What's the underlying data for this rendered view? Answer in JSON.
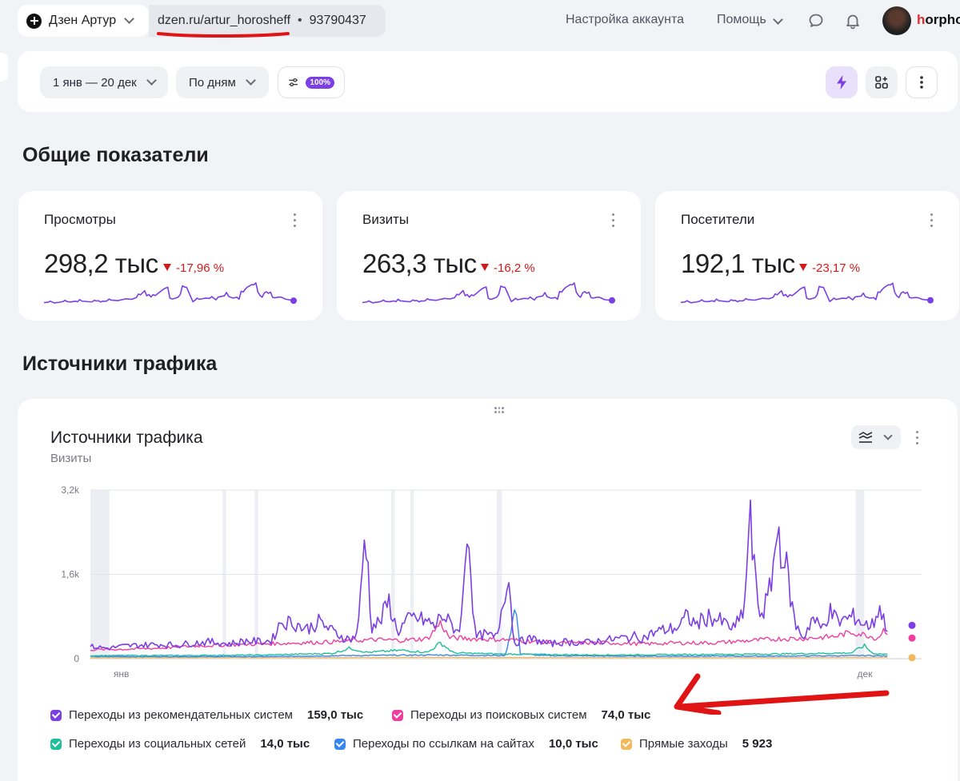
{
  "topbar": {
    "channel_name": "Дзен Артур",
    "url": "dzen.ru/artur_horosheff",
    "separator": "•",
    "channel_id": "93790437",
    "account_settings": "Настройка аккаунта",
    "help": "Помощь",
    "username_first": "h",
    "username_rest": "orpho",
    "icons": [
      "chevron-down-icon",
      "chat-icon",
      "bell-icon",
      "avatar"
    ]
  },
  "filters": {
    "date_range": "1 янв — 20 дек",
    "grouping": "По дням",
    "sampling_badge": "100%",
    "icons": [
      "sliders-icon",
      "lightning-icon",
      "widgets-icon",
      "more-icon"
    ]
  },
  "sections": {
    "overview_title": "Общие показатели",
    "traffic_title": "Источники трафика"
  },
  "metrics": [
    {
      "title": "Просмотры",
      "value": "298,2 тыс",
      "delta": "-17,96 %"
    },
    {
      "title": "Визиты",
      "value": "263,3 тыс",
      "delta": "-16,2 %"
    },
    {
      "title": "Посетители",
      "value": "192,1 тыс",
      "delta": "-23,17 %"
    }
  ],
  "traffic_card": {
    "title": "Источники трафика",
    "subtitle": "Визиты"
  },
  "colors": {
    "accent": "#7b3fe4",
    "negative": "#d11a1a",
    "series_recommend": "#7b3fe4",
    "series_search": "#ee3f9f",
    "series_social": "#1fbf9a",
    "series_links": "#3a86f0",
    "series_direct": "#f2b95c"
  },
  "chart_data": {
    "type": "line",
    "title": "Источники трафика",
    "subtitle": "Визиты",
    "y_ticks": [
      "3,2k",
      "1,6k",
      "0"
    ],
    "ylim": [
      0,
      3200
    ],
    "x_tick_labels": [
      "янв",
      "дек"
    ],
    "x_range": [
      "1 янв",
      "20 дек"
    ],
    "grid": true,
    "legend_position": "bottom",
    "series": [
      {
        "name": "Переходы из рекомендательных систем",
        "total": "159,0 тыс",
        "color": "#7b3fe4",
        "keypoints": [
          [
            0,
            230
          ],
          [
            20,
            200
          ],
          [
            40,
            240
          ],
          [
            60,
            260
          ],
          [
            80,
            270
          ],
          [
            100,
            260
          ],
          [
            120,
            300
          ],
          [
            140,
            320
          ],
          [
            160,
            280
          ],
          [
            180,
            340
          ],
          [
            200,
            320
          ],
          [
            210,
            350
          ],
          [
            220,
            700
          ],
          [
            235,
            680
          ],
          [
            250,
            560
          ],
          [
            265,
            700
          ],
          [
            280,
            520
          ],
          [
            295,
            380
          ],
          [
            305,
            390
          ],
          [
            310,
            620
          ],
          [
            318,
            2530
          ],
          [
            325,
            600
          ],
          [
            335,
            700
          ],
          [
            345,
            1100
          ],
          [
            355,
            500
          ],
          [
            365,
            700
          ],
          [
            375,
            780
          ],
          [
            390,
            700
          ],
          [
            400,
            600
          ],
          [
            405,
            860
          ],
          [
            415,
            680
          ],
          [
            425,
            520
          ],
          [
            430,
            820
          ],
          [
            436,
            2730
          ],
          [
            445,
            400
          ],
          [
            455,
            460
          ],
          [
            470,
            400
          ],
          [
            483,
            1680
          ],
          [
            490,
            300
          ],
          [
            510,
            380
          ],
          [
            530,
            280
          ],
          [
            550,
            320
          ],
          [
            570,
            300
          ],
          [
            590,
            340
          ],
          [
            610,
            380
          ],
          [
            630,
            420
          ],
          [
            640,
            400
          ],
          [
            655,
            520
          ],
          [
            670,
            560
          ],
          [
            680,
            600
          ],
          [
            690,
            800
          ],
          [
            700,
            650
          ],
          [
            715,
            800
          ],
          [
            730,
            700
          ],
          [
            745,
            560
          ],
          [
            755,
            900
          ],
          [
            758,
            1200
          ],
          [
            762,
            2820
          ],
          [
            768,
            1600
          ],
          [
            775,
            800
          ],
          [
            785,
            1200
          ],
          [
            795,
            2450
          ],
          [
            805,
            1700
          ],
          [
            815,
            650
          ],
          [
            825,
            400
          ],
          [
            835,
            780
          ],
          [
            845,
            560
          ],
          [
            855,
            900
          ],
          [
            865,
            700
          ],
          [
            875,
            760
          ],
          [
            885,
            800
          ],
          [
            895,
            640
          ],
          [
            905,
            640
          ],
          [
            912,
            1000
          ],
          [
            918,
            700
          ],
          [
            924,
            560
          ]
        ]
      },
      {
        "name": "Переходы из поисковых систем",
        "total": "74,0 тыс",
        "color": "#ee3f9f",
        "keypoints": [
          [
            0,
            170
          ],
          [
            40,
            180
          ],
          [
            80,
            200
          ],
          [
            120,
            240
          ],
          [
            160,
            260
          ],
          [
            200,
            280
          ],
          [
            240,
            300
          ],
          [
            280,
            320
          ],
          [
            300,
            340
          ],
          [
            330,
            360
          ],
          [
            360,
            350
          ],
          [
            390,
            380
          ],
          [
            405,
            680
          ],
          [
            415,
            400
          ],
          [
            440,
            380
          ],
          [
            480,
            360
          ],
          [
            520,
            320
          ],
          [
            560,
            300
          ],
          [
            600,
            300
          ],
          [
            640,
            280
          ],
          [
            680,
            300
          ],
          [
            720,
            300
          ],
          [
            760,
            340
          ],
          [
            780,
            360
          ],
          [
            800,
            380
          ],
          [
            820,
            380
          ],
          [
            840,
            400
          ],
          [
            860,
            420
          ],
          [
            880,
            500
          ],
          [
            900,
            440
          ],
          [
            910,
            380
          ],
          [
            918,
            560
          ],
          [
            924,
            480
          ]
        ]
      },
      {
        "name": "Переходы из социальных сетей",
        "total": "14,0 тыс",
        "color": "#1fbf9a",
        "keypoints": [
          [
            0,
            60
          ],
          [
            100,
            60
          ],
          [
            200,
            70
          ],
          [
            280,
            100
          ],
          [
            300,
            200
          ],
          [
            320,
            120
          ],
          [
            360,
            160
          ],
          [
            390,
            120
          ],
          [
            405,
            300
          ],
          [
            420,
            110
          ],
          [
            470,
            90
          ],
          [
            520,
            80
          ],
          [
            600,
            70
          ],
          [
            700,
            80
          ],
          [
            800,
            90
          ],
          [
            880,
            110
          ],
          [
            895,
            250
          ],
          [
            905,
            100
          ],
          [
            924,
            80
          ]
        ]
      },
      {
        "name": "Переходы по ссылкам на сайтах",
        "total": "10,0 тыс",
        "color": "#3a86f0",
        "keypoints": [
          [
            0,
            40
          ],
          [
            100,
            40
          ],
          [
            200,
            40
          ],
          [
            300,
            60
          ],
          [
            400,
            70
          ],
          [
            480,
            60
          ],
          [
            492,
            1000
          ],
          [
            497,
            100
          ],
          [
            520,
            60
          ],
          [
            600,
            50
          ],
          [
            700,
            50
          ],
          [
            800,
            50
          ],
          [
            900,
            60
          ],
          [
            924,
            50
          ]
        ]
      },
      {
        "name": "Прямые заходы",
        "total": "5 923",
        "color": "#f2b95c",
        "keypoints": [
          [
            0,
            20
          ],
          [
            200,
            22
          ],
          [
            400,
            24
          ],
          [
            600,
            22
          ],
          [
            800,
            24
          ],
          [
            924,
            26
          ]
        ]
      }
    ]
  },
  "metric_sparklines": [
    [
      3,
      4,
      3,
      5,
      4,
      6,
      5,
      4,
      6,
      5,
      7,
      6,
      9,
      8,
      12,
      22,
      10,
      18,
      26,
      8,
      12,
      30,
      6,
      8,
      10,
      9,
      12,
      14,
      10,
      12,
      26,
      32,
      14,
      20,
      10,
      12,
      8,
      6
    ],
    [
      3,
      4,
      3,
      5,
      4,
      6,
      5,
      4,
      6,
      5,
      7,
      6,
      9,
      8,
      11,
      21,
      9,
      17,
      25,
      7,
      11,
      28,
      6,
      7,
      9,
      8,
      11,
      13,
      9,
      11,
      24,
      30,
      13,
      19,
      9,
      11,
      7,
      6
    ],
    [
      3,
      4,
      3,
      5,
      4,
      6,
      5,
      4,
      6,
      5,
      7,
      6,
      9,
      8,
      11,
      20,
      9,
      16,
      24,
      7,
      10,
      27,
      6,
      7,
      9,
      8,
      11,
      12,
      9,
      10,
      23,
      29,
      12,
      18,
      9,
      10,
      7,
      6
    ]
  ]
}
